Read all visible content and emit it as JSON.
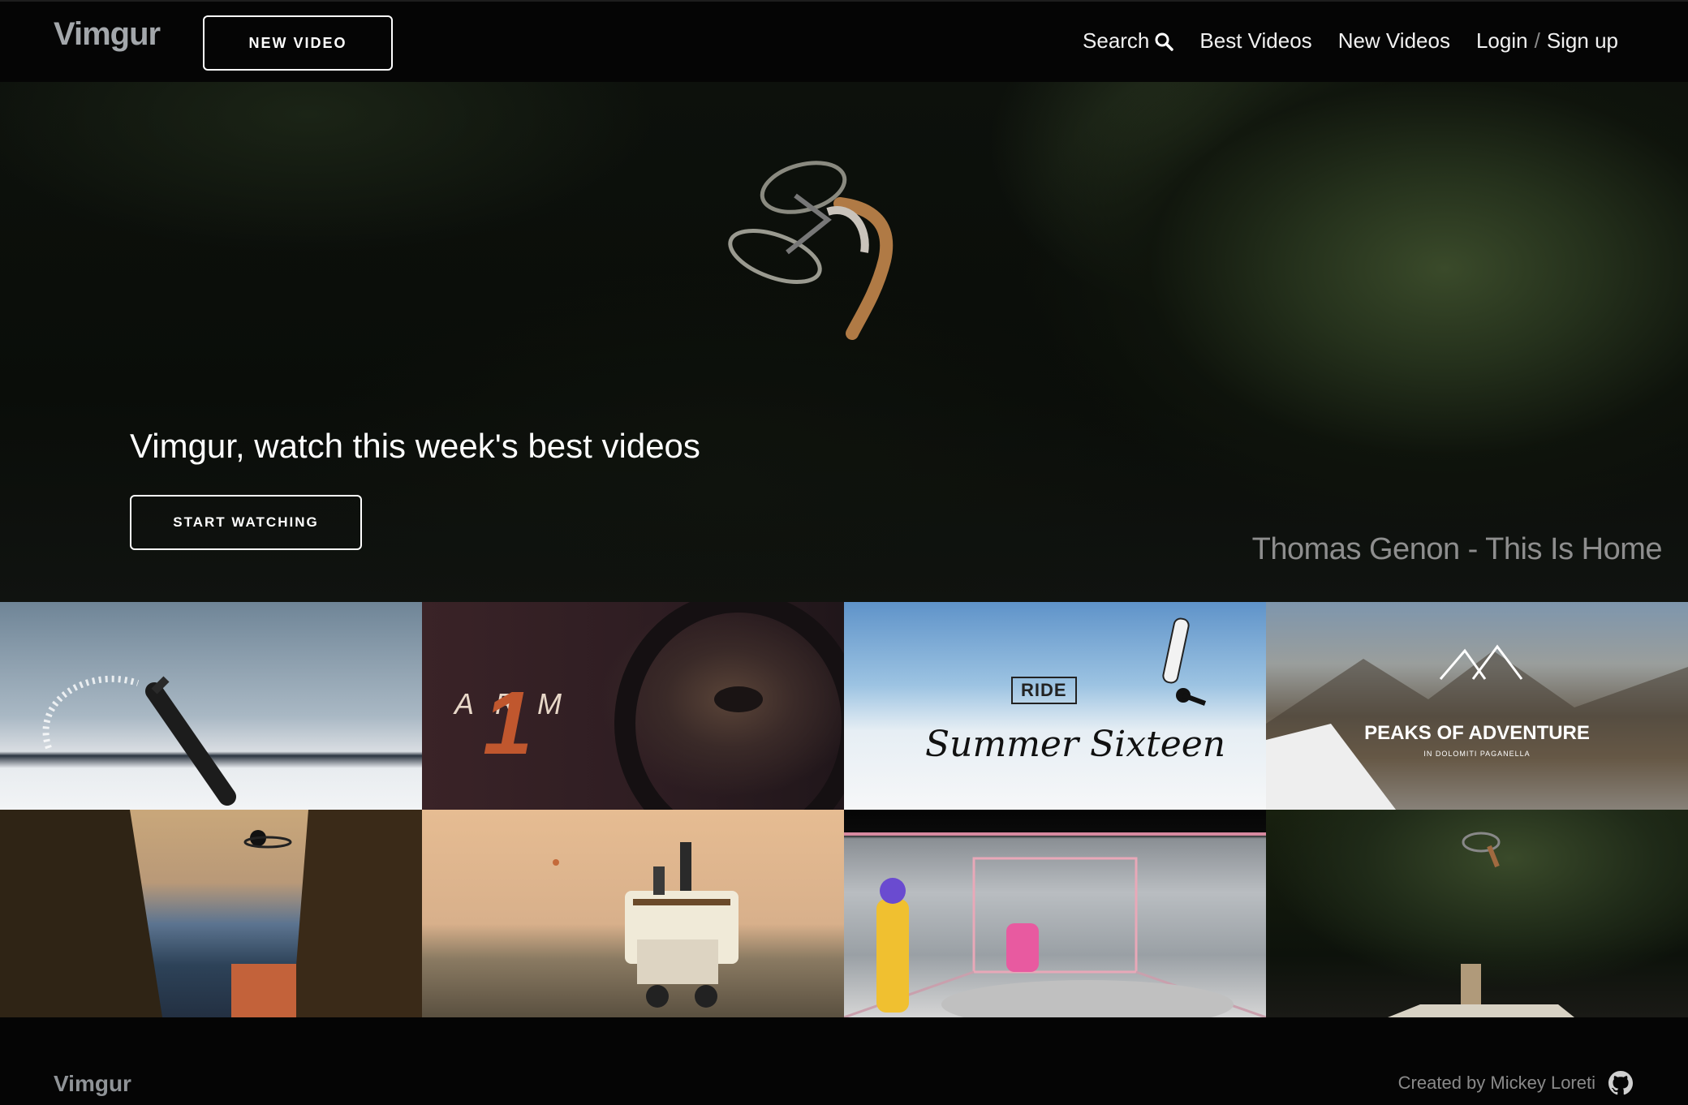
{
  "nav": {
    "logo": "Vimgur",
    "new_video_label": "NEW VIDEO",
    "links": {
      "search": "Search",
      "best": "Best Videos",
      "new": "New Videos",
      "login": "Login",
      "separator": "/",
      "signup": "Sign up"
    }
  },
  "hero": {
    "title": "Vimgur, watch this week's best videos",
    "button_label": "START WATCHING",
    "caption": "Thomas Genon - This Is Home"
  },
  "tiles": [
    {
      "text": "",
      "subtext": ""
    },
    {
      "text": "ARM",
      "subtext": "1"
    },
    {
      "text": "RIDE",
      "subtext": "Summer Sixteen"
    },
    {
      "text": "PEAKS OF ADVENTURE",
      "subtext": "IN DOLOMITI PAGANELLA"
    },
    {
      "text": "",
      "subtext": ""
    },
    {
      "text": "",
      "subtext": ""
    },
    {
      "text": "",
      "subtext": ""
    },
    {
      "text": "",
      "subtext": ""
    }
  ],
  "footer": {
    "logo": "Vimgur",
    "credit": "Created by Mickey Loreti"
  },
  "icons": {
    "search": "search-icon",
    "github": "github-icon"
  }
}
